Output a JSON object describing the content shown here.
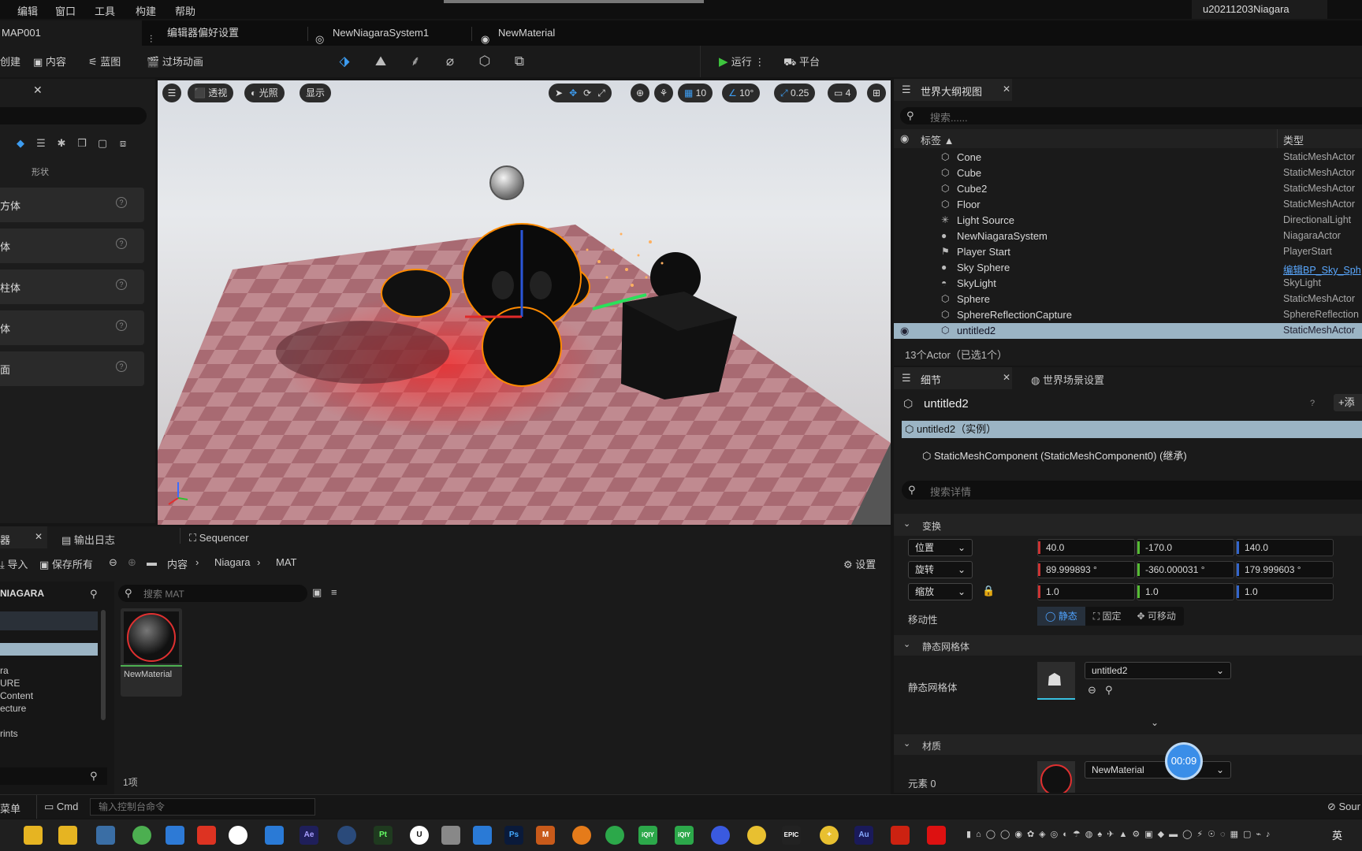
{
  "menu": [
    "编辑",
    "窗口",
    "工具",
    "构建",
    "帮助"
  ],
  "project_title": "u20211203Niagara",
  "tabs": {
    "map": "MAP001",
    "prefs": "编辑器偏好设置",
    "niagara": "NewNiagaraSystem1",
    "material": "NewMaterial"
  },
  "toolbar": {
    "create": "创建",
    "content": "内容",
    "blueprint": "蓝图",
    "cinematics": "过场动画",
    "play": "运行",
    "platform": "平台"
  },
  "left_panel": {
    "section_label": "形状",
    "items": [
      "方体",
      "体",
      "柱体",
      "体",
      "面"
    ]
  },
  "viewport": {
    "perspective": "透视",
    "lighting": "光照",
    "show": "显示",
    "grid_snap": "10",
    "rot_snap": "10°",
    "scale_snap": "0.25",
    "camera_speed": "4"
  },
  "outliner": {
    "tab": "世界大纲视图",
    "search_placeholder": "搜索......",
    "col_label": "标签 ▲",
    "col_type": "类型",
    "rows": [
      {
        "name": "Cone",
        "type": "StaticMeshActor",
        "icon": "mesh-icon"
      },
      {
        "name": "Cube",
        "type": "StaticMeshActor",
        "icon": "mesh-icon"
      },
      {
        "name": "Cube2",
        "type": "StaticMeshActor",
        "icon": "mesh-icon"
      },
      {
        "name": "Floor",
        "type": "StaticMeshActor",
        "icon": "mesh-icon"
      },
      {
        "name": "Light Source",
        "type": "DirectionalLight",
        "icon": "sun-icon"
      },
      {
        "name": "NewNiagaraSystem",
        "type": "NiagaraActor",
        "icon": "niagara-icon"
      },
      {
        "name": "Player Start",
        "type": "PlayerStart",
        "icon": "flag-icon"
      },
      {
        "name": "Sky Sphere",
        "type": "编辑BP_Sky_Sph",
        "icon": "sphere-icon"
      },
      {
        "name": "SkyLight",
        "type": "SkyLight",
        "icon": "skylight-icon"
      },
      {
        "name": "Sphere",
        "type": "StaticMeshActor",
        "icon": "mesh-icon"
      },
      {
        "name": "SphereReflectionCapture",
        "type": "SphereReflection",
        "icon": "mesh-icon"
      },
      {
        "name": "untitled2",
        "type": "StaticMeshActor",
        "icon": "mesh-icon",
        "selected": true
      }
    ],
    "footer": "13个Actor（已选1个）"
  },
  "details": {
    "tab": "细节",
    "world_tab": "世界场景设置",
    "object_name": "untitled2",
    "add_button": "添",
    "instance": "untitled2（实例）",
    "component": "StaticMeshComponent (StaticMeshComponent0) (继承)",
    "search_placeholder": "搜索详情",
    "transform_header": "变换",
    "location_label": "位置",
    "rotation_label": "旋转",
    "scale_label": "缩放",
    "location": [
      "40.0",
      "-170.0",
      "140.0"
    ],
    "rotation": [
      "89.999893 °",
      "-360.000031 °",
      "179.999603 °"
    ],
    "scale": [
      "1.0",
      "1.0",
      "1.0"
    ],
    "mobility_label": "移动性",
    "mobility": [
      "静态",
      "固定",
      "可移动"
    ],
    "static_mesh_header": "静态网格体",
    "static_mesh_label": "静态网格体",
    "static_mesh_value": "untitled2",
    "materials_header": "材质",
    "element0_label": "元素 0",
    "element0_value": "NewMaterial",
    "timer": "00:09"
  },
  "bottom": {
    "tab_content": "器",
    "tab_output": "输出日志",
    "tab_sequencer": "Sequencer",
    "import": "导入",
    "save_all": "保存所有",
    "path": [
      "内容",
      "Niagara",
      "MAT"
    ],
    "settings": "设置",
    "folder_header": "NIAGARA",
    "folders": [
      "ra",
      "URE",
      "Content",
      "ecture",
      "rints"
    ],
    "search_placeholder": "搜索 MAT",
    "asset_name": "NewMaterial",
    "item_count": "1项"
  },
  "status": {
    "menu": "菜单",
    "cmd": "Cmd",
    "cmd_placeholder": "输入控制台命令",
    "source": "Sour"
  },
  "taskbar": {
    "lang": "英",
    "apps": [
      "Ae",
      "Pt",
      "Ps",
      "Au",
      "EPIC"
    ]
  }
}
